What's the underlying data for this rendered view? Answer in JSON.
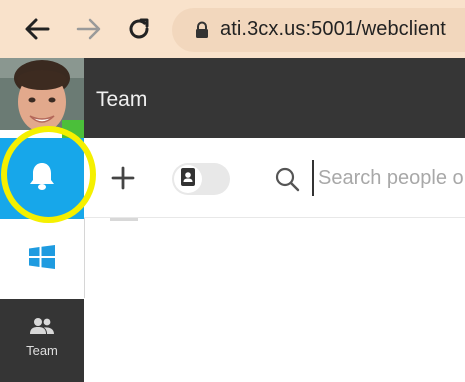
{
  "browser": {
    "url": "ati.3cx.us:5001/webclient",
    "icons": [
      "back-arrow-icon",
      "forward-arrow-icon",
      "reload-icon",
      "lock-icon"
    ]
  },
  "app": {
    "title": "Team"
  },
  "sidebar": {
    "items": [
      {
        "name": "notifications",
        "icon": "bell-icon"
      },
      {
        "name": "windows",
        "icon": "windows-logo-icon"
      },
      {
        "name": "team",
        "icon": "team-icon",
        "label": "Team"
      }
    ]
  },
  "toolbar": {
    "search_placeholder": "Search people o",
    "icons": [
      "plus-icon",
      "contact-card-icon",
      "search-icon"
    ]
  },
  "colors": {
    "browser_bar": "#f9e2cb",
    "header": "#363636",
    "bell_tile": "#17a7ea",
    "highlight": "#f5f000",
    "team_tile": "#353535"
  }
}
